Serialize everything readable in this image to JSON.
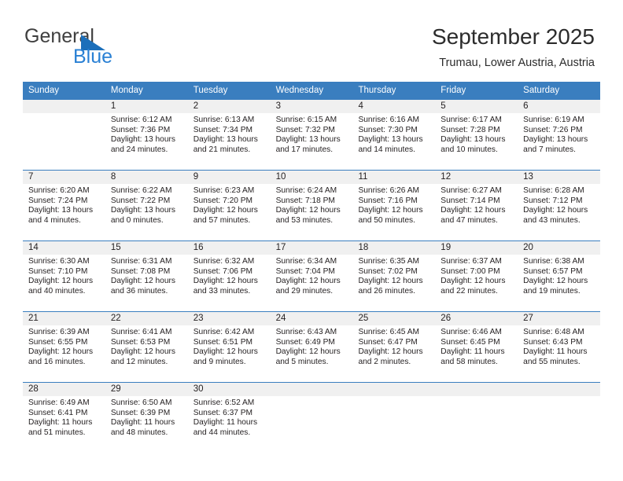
{
  "brand": {
    "name_part1": "General",
    "name_part2": "Blue",
    "logo_icon": "triangle-logo-icon",
    "accent_color": "#1c6fba",
    "blue_text_color": "#2980d4"
  },
  "header": {
    "title": "September 2025",
    "location": "Trumau, Lower Austria, Austria"
  },
  "calendar": {
    "header_bg_color": "#3a7ebf",
    "daynum_bg_color": "#f0f0f0",
    "weekdays": [
      "Sunday",
      "Monday",
      "Tuesday",
      "Wednesday",
      "Thursday",
      "Friday",
      "Saturday"
    ],
    "weeks": [
      [
        {
          "day": "",
          "lines": []
        },
        {
          "day": "1",
          "lines": [
            "Sunrise: 6:12 AM",
            "Sunset: 7:36 PM",
            "Daylight: 13 hours",
            "and 24 minutes."
          ]
        },
        {
          "day": "2",
          "lines": [
            "Sunrise: 6:13 AM",
            "Sunset: 7:34 PM",
            "Daylight: 13 hours",
            "and 21 minutes."
          ]
        },
        {
          "day": "3",
          "lines": [
            "Sunrise: 6:15 AM",
            "Sunset: 7:32 PM",
            "Daylight: 13 hours",
            "and 17 minutes."
          ]
        },
        {
          "day": "4",
          "lines": [
            "Sunrise: 6:16 AM",
            "Sunset: 7:30 PM",
            "Daylight: 13 hours",
            "and 14 minutes."
          ]
        },
        {
          "day": "5",
          "lines": [
            "Sunrise: 6:17 AM",
            "Sunset: 7:28 PM",
            "Daylight: 13 hours",
            "and 10 minutes."
          ]
        },
        {
          "day": "6",
          "lines": [
            "Sunrise: 6:19 AM",
            "Sunset: 7:26 PM",
            "Daylight: 13 hours",
            "and 7 minutes."
          ]
        }
      ],
      [
        {
          "day": "7",
          "lines": [
            "Sunrise: 6:20 AM",
            "Sunset: 7:24 PM",
            "Daylight: 13 hours",
            "and 4 minutes."
          ]
        },
        {
          "day": "8",
          "lines": [
            "Sunrise: 6:22 AM",
            "Sunset: 7:22 PM",
            "Daylight: 13 hours",
            "and 0 minutes."
          ]
        },
        {
          "day": "9",
          "lines": [
            "Sunrise: 6:23 AM",
            "Sunset: 7:20 PM",
            "Daylight: 12 hours",
            "and 57 minutes."
          ]
        },
        {
          "day": "10",
          "lines": [
            "Sunrise: 6:24 AM",
            "Sunset: 7:18 PM",
            "Daylight: 12 hours",
            "and 53 minutes."
          ]
        },
        {
          "day": "11",
          "lines": [
            "Sunrise: 6:26 AM",
            "Sunset: 7:16 PM",
            "Daylight: 12 hours",
            "and 50 minutes."
          ]
        },
        {
          "day": "12",
          "lines": [
            "Sunrise: 6:27 AM",
            "Sunset: 7:14 PM",
            "Daylight: 12 hours",
            "and 47 minutes."
          ]
        },
        {
          "day": "13",
          "lines": [
            "Sunrise: 6:28 AM",
            "Sunset: 7:12 PM",
            "Daylight: 12 hours",
            "and 43 minutes."
          ]
        }
      ],
      [
        {
          "day": "14",
          "lines": [
            "Sunrise: 6:30 AM",
            "Sunset: 7:10 PM",
            "Daylight: 12 hours",
            "and 40 minutes."
          ]
        },
        {
          "day": "15",
          "lines": [
            "Sunrise: 6:31 AM",
            "Sunset: 7:08 PM",
            "Daylight: 12 hours",
            "and 36 minutes."
          ]
        },
        {
          "day": "16",
          "lines": [
            "Sunrise: 6:32 AM",
            "Sunset: 7:06 PM",
            "Daylight: 12 hours",
            "and 33 minutes."
          ]
        },
        {
          "day": "17",
          "lines": [
            "Sunrise: 6:34 AM",
            "Sunset: 7:04 PM",
            "Daylight: 12 hours",
            "and 29 minutes."
          ]
        },
        {
          "day": "18",
          "lines": [
            "Sunrise: 6:35 AM",
            "Sunset: 7:02 PM",
            "Daylight: 12 hours",
            "and 26 minutes."
          ]
        },
        {
          "day": "19",
          "lines": [
            "Sunrise: 6:37 AM",
            "Sunset: 7:00 PM",
            "Daylight: 12 hours",
            "and 22 minutes."
          ]
        },
        {
          "day": "20",
          "lines": [
            "Sunrise: 6:38 AM",
            "Sunset: 6:57 PM",
            "Daylight: 12 hours",
            "and 19 minutes."
          ]
        }
      ],
      [
        {
          "day": "21",
          "lines": [
            "Sunrise: 6:39 AM",
            "Sunset: 6:55 PM",
            "Daylight: 12 hours",
            "and 16 minutes."
          ]
        },
        {
          "day": "22",
          "lines": [
            "Sunrise: 6:41 AM",
            "Sunset: 6:53 PM",
            "Daylight: 12 hours",
            "and 12 minutes."
          ]
        },
        {
          "day": "23",
          "lines": [
            "Sunrise: 6:42 AM",
            "Sunset: 6:51 PM",
            "Daylight: 12 hours",
            "and 9 minutes."
          ]
        },
        {
          "day": "24",
          "lines": [
            "Sunrise: 6:43 AM",
            "Sunset: 6:49 PM",
            "Daylight: 12 hours",
            "and 5 minutes."
          ]
        },
        {
          "day": "25",
          "lines": [
            "Sunrise: 6:45 AM",
            "Sunset: 6:47 PM",
            "Daylight: 12 hours",
            "and 2 minutes."
          ]
        },
        {
          "day": "26",
          "lines": [
            "Sunrise: 6:46 AM",
            "Sunset: 6:45 PM",
            "Daylight: 11 hours",
            "and 58 minutes."
          ]
        },
        {
          "day": "27",
          "lines": [
            "Sunrise: 6:48 AM",
            "Sunset: 6:43 PM",
            "Daylight: 11 hours",
            "and 55 minutes."
          ]
        }
      ],
      [
        {
          "day": "28",
          "lines": [
            "Sunrise: 6:49 AM",
            "Sunset: 6:41 PM",
            "Daylight: 11 hours",
            "and 51 minutes."
          ]
        },
        {
          "day": "29",
          "lines": [
            "Sunrise: 6:50 AM",
            "Sunset: 6:39 PM",
            "Daylight: 11 hours",
            "and 48 minutes."
          ]
        },
        {
          "day": "30",
          "lines": [
            "Sunrise: 6:52 AM",
            "Sunset: 6:37 PM",
            "Daylight: 11 hours",
            "and 44 minutes."
          ]
        },
        {
          "day": "",
          "lines": []
        },
        {
          "day": "",
          "lines": []
        },
        {
          "day": "",
          "lines": []
        },
        {
          "day": "",
          "lines": []
        }
      ]
    ]
  }
}
